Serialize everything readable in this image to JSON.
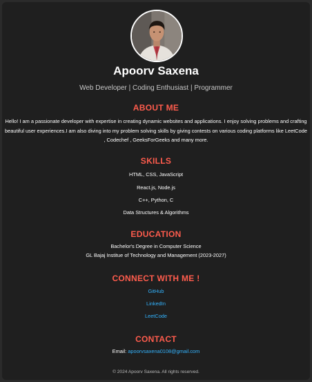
{
  "profile": {
    "name": "Apoorv Saxena",
    "tagline": "Web Developer | Coding Enthusiast | Programmer"
  },
  "about": {
    "title": "ABOUT ME",
    "text": "Hello! I am a passionate developer with expertise in creating dynamic websites and applications. I enjoy solving problems and crafting beautiful user experiences.I am also diving into my problem solving skills by giving contests on various coding platforms like LeetCode , Codechef , GeeksForGeeks and many more."
  },
  "skills": {
    "title": "SKILLS",
    "items": [
      "HTML, CSS, JavaScript",
      "React.js, Node.js",
      "C++, Python, C",
      "Data Structures & Algorithms"
    ]
  },
  "education": {
    "title": "EDUCATION",
    "degree": "Bachelor's Degree in Computer Science",
    "institute": "GL Bajaj Institue of Technology and Management (2023-2027)"
  },
  "connect": {
    "title": "CONNECT WITH ME !",
    "links": [
      "GitHub",
      "LinkedIn",
      "LeetCode"
    ]
  },
  "contact": {
    "title": "CONTACT",
    "email_label": "Email:",
    "email": "apoorvsaxena0108@gmail.com"
  },
  "footer": "© 2024 Apoorv Saxena. All rights reserved.",
  "colors": {
    "background": "#2b2b2b",
    "card": "#1f1f1f",
    "heading": "#ff5c4d",
    "link": "#33b4ff"
  }
}
